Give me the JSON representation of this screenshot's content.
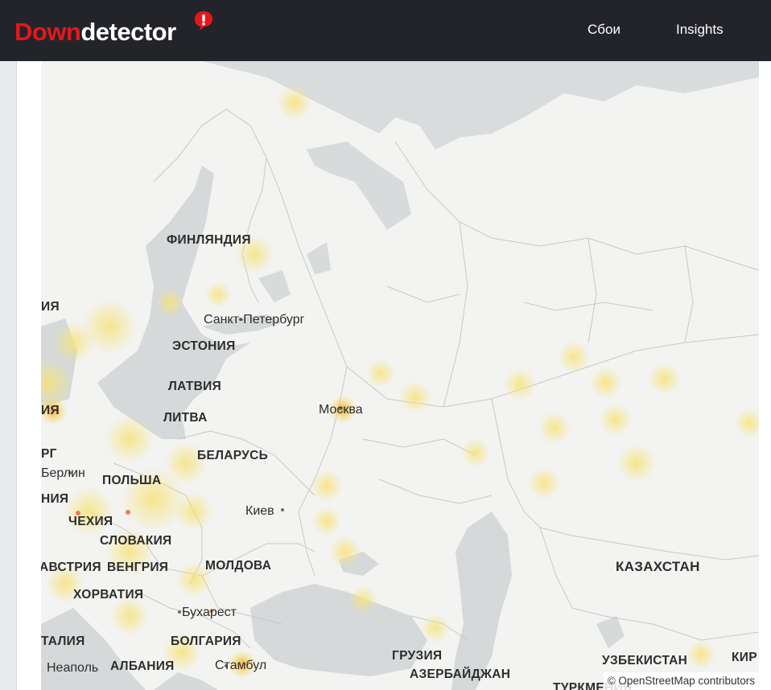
{
  "header": {
    "logo_part1": "Down",
    "logo_part2": "detector",
    "nav": [
      "Сбои",
      "Insights"
    ]
  },
  "map": {
    "attribution": "© OpenStreetMap contributors",
    "labels": [
      {
        "text": "ФИНЛЯНДИЯ",
        "kind": "country"
      },
      {
        "text": "Санкт-Петербург",
        "kind": "city"
      },
      {
        "text": "ЭСТОНИЯ",
        "kind": "country"
      },
      {
        "text": "ЛАТВИЯ",
        "kind": "country"
      },
      {
        "text": "ЛИТВА",
        "kind": "country"
      },
      {
        "text": "Москва",
        "kind": "city"
      },
      {
        "text": "БЕЛАРУСЬ",
        "kind": "country"
      },
      {
        "text": "Берлин",
        "kind": "city"
      },
      {
        "text": "ПОЛЬША",
        "kind": "country"
      },
      {
        "text": "ЧЕХИЯ",
        "kind": "country"
      },
      {
        "text": "Киев",
        "kind": "city"
      },
      {
        "text": "СЛОВАКИЯ",
        "kind": "country"
      },
      {
        "text": "АВСТРИЯ",
        "kind": "country"
      },
      {
        "text": "ВЕНГРИЯ",
        "kind": "country"
      },
      {
        "text": "МОЛДОВА",
        "kind": "country"
      },
      {
        "text": "ХОРВАТИЯ",
        "kind": "country"
      },
      {
        "text": "Бухарест",
        "kind": "city"
      },
      {
        "text": "БОЛГАРИЯ",
        "kind": "country"
      },
      {
        "text": "ТАЛИЯ",
        "kind": "country"
      },
      {
        "text": "Неаполь",
        "kind": "city"
      },
      {
        "text": "АЛБАНИЯ",
        "kind": "country"
      },
      {
        "text": "Стамбул",
        "kind": "city"
      },
      {
        "text": "ГРУЗИЯ",
        "kind": "country"
      },
      {
        "text": "АЗЕРБАЙДЖАН",
        "kind": "country"
      },
      {
        "text": "КАЗАХСТАН",
        "kind": "country"
      },
      {
        "text": "УЗБЕКИСТАН",
        "kind": "country"
      },
      {
        "text": "КИР",
        "kind": "country"
      },
      {
        "text": "ТУРКМЕНИЯ",
        "kind": "country"
      },
      {
        "text": "ИЯ",
        "kind": "country"
      },
      {
        "text": "ИЯ",
        "kind": "country"
      },
      {
        "text": "РГ",
        "kind": "country"
      },
      {
        "text": "НИЯ",
        "kind": "country"
      }
    ]
  },
  "colors": {
    "header_bg": "#23242a",
    "brand_red": "#e5171b",
    "land": "#f3f3f1",
    "water": "#cfd4d6",
    "heat_yellow": "#f7e37a",
    "heat_orange": "#f3a53b"
  }
}
